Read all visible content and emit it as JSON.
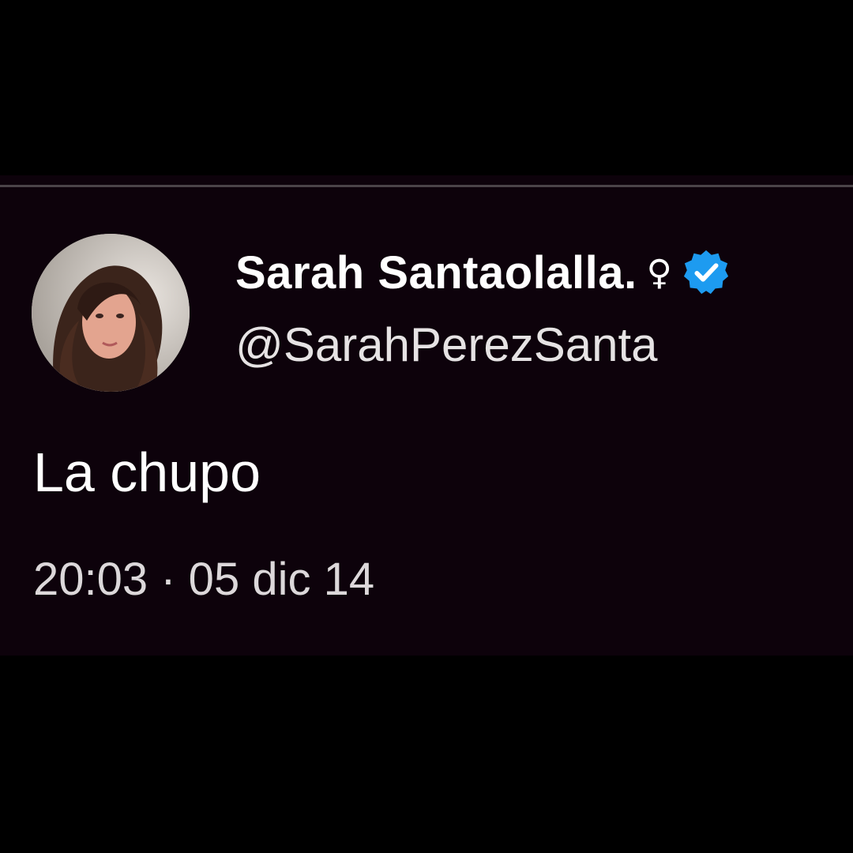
{
  "tweet": {
    "display_name": "Sarah Santaolalla.",
    "name_symbol": "♀",
    "handle": "@SarahPerezSanta",
    "text": "La chupo",
    "timestamp": "20:03 · 05 dic 14",
    "avatar_icon": "profile-photo",
    "verified_icon": "verified-badge-icon"
  },
  "colors": {
    "page_background": "#000000",
    "card_background": "#0d020b",
    "verified_blue": "#1d9bf0",
    "text_primary": "#ffffff",
    "text_secondary": "#dcd8da"
  }
}
